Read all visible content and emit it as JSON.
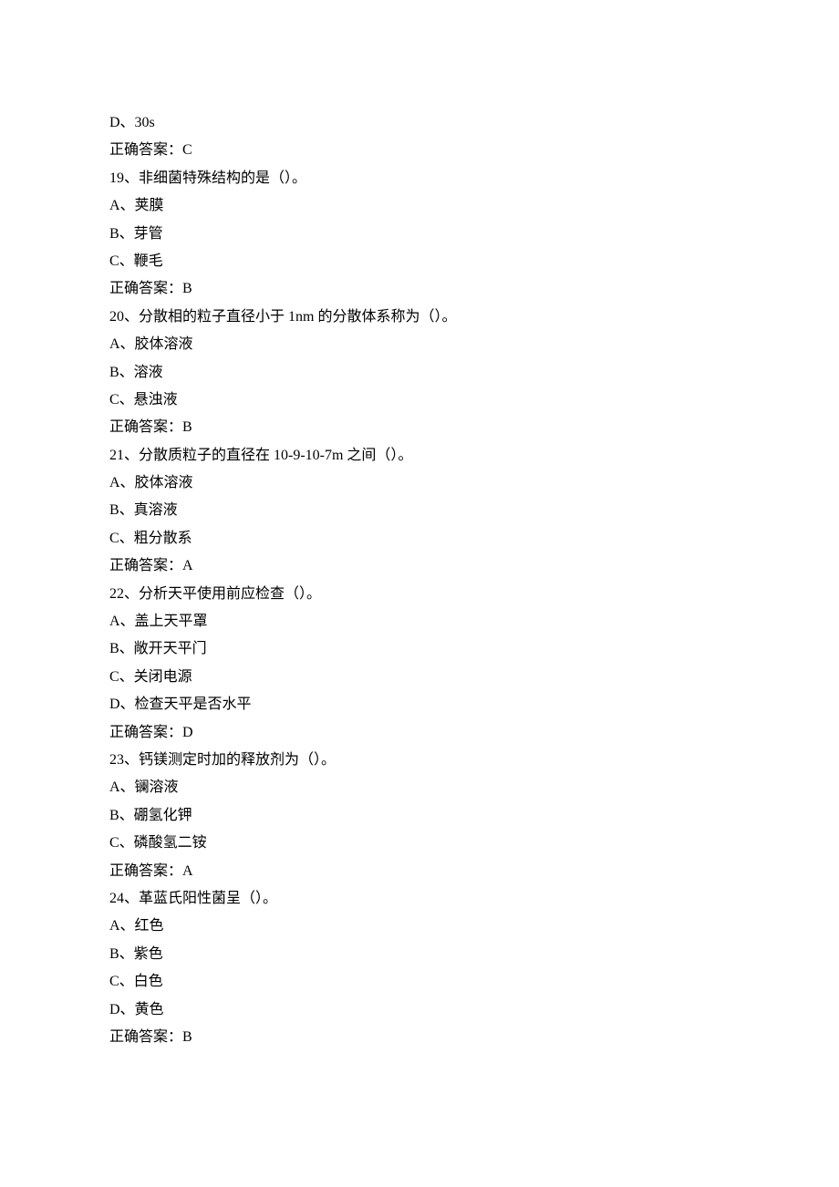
{
  "lines": [
    "D、30s",
    "正确答案：C",
    "19、非细菌特殊结构的是（）。",
    "A、荚膜",
    "B、芽管",
    "C、鞭毛",
    "正确答案：B",
    "20、分散相的粒子直径小于 1nm 的分散体系称为（）。",
    "A、胶体溶液",
    "B、溶液",
    "C、悬浊液",
    "正确答案：B",
    "21、分散质粒子的直径在 10-9-10-7m 之间（）。",
    "A、胶体溶液",
    "B、真溶液",
    "C、粗分散系",
    "正确答案：A",
    "22、分析天平使用前应检查（）。",
    "A、盖上天平罩",
    "B、敞开天平门",
    "C、关闭电源",
    "D、检查天平是否水平",
    "正确答案：D",
    "23、钙镁测定时加的释放剂为（）。",
    "A、镧溶液",
    "B、硼氢化钾",
    "C、磷酸氢二铵",
    "正确答案：A",
    "24、革蓝氏阳性菌呈（）。",
    "A、红色",
    "B、紫色",
    "C、白色",
    "D、黄色",
    "正确答案：B"
  ]
}
